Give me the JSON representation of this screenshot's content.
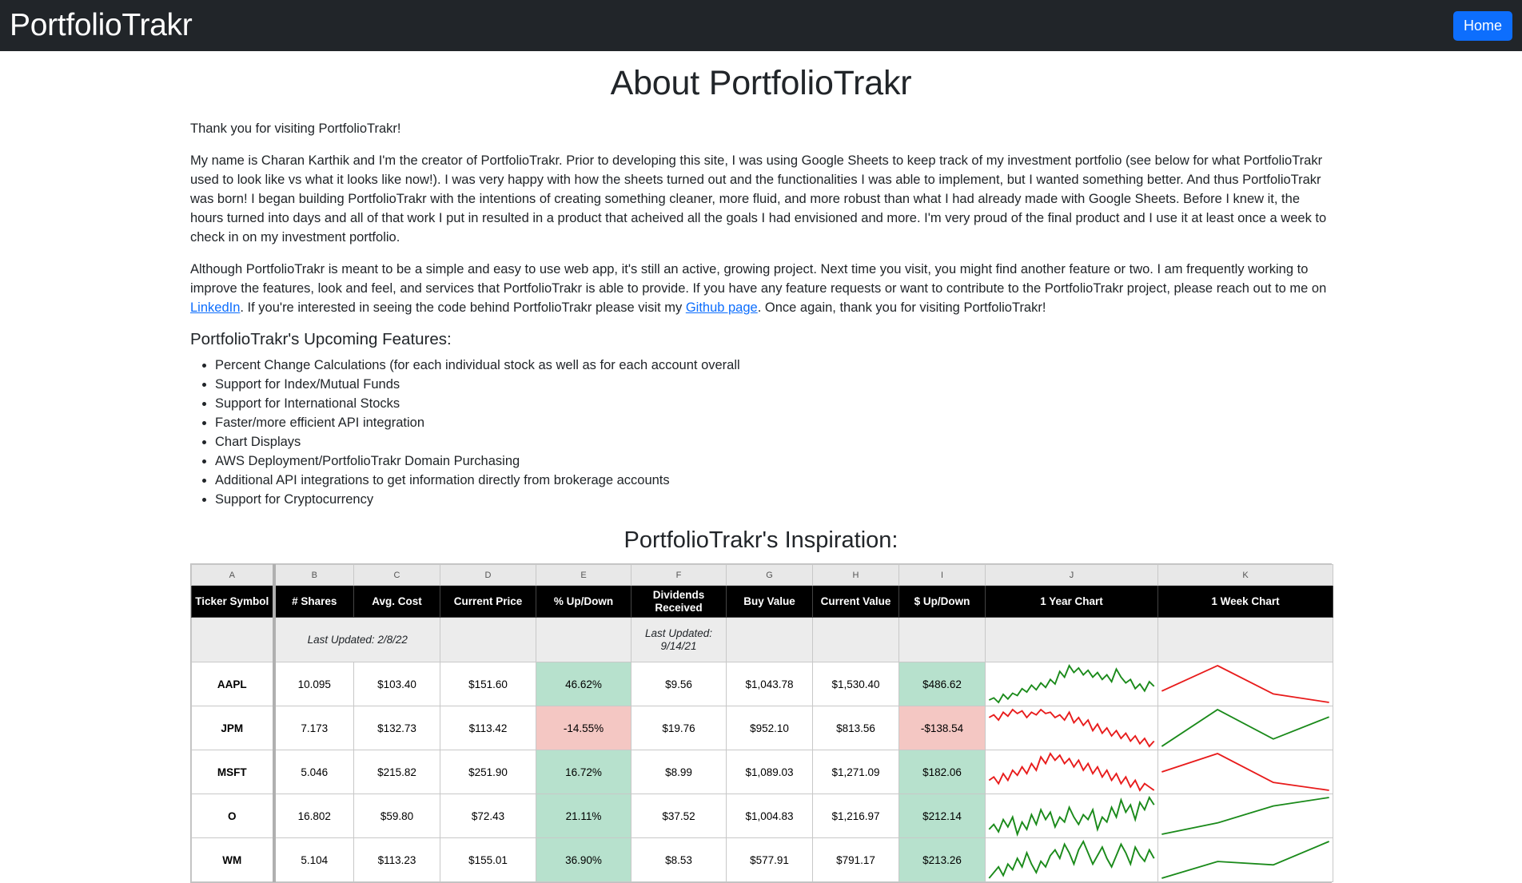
{
  "nav": {
    "brand": "PortfolioTrakr",
    "home": "Home"
  },
  "about": {
    "title": "About PortfolioTrakr",
    "greeting": "Thank you for visiting PortfolioTrakr!",
    "p1": "My name is Charan Karthik and I'm the creator of PortfolioTrakr. Prior to developing this site, I was using Google Sheets to keep track of my investment portfolio (see below for what PortfolioTrakr used to look like vs what it looks like now!). I was very happy with how the sheets turned out and the functionalities I was able to implement, but I wanted something better. And thus PortfolioTrakr was born! I began building PortfolioTrakr with the intentions of creating something cleaner, more fluid, and more robust than what I had already made with Google Sheets. Before I knew it, the hours turned into days and all of that work I put in resulted in a product that acheived all the goals I had envisioned and more. I'm very proud of the final product and I use it at least once a week to check in on my investment portfolio.",
    "p2_a": "Although PortfolioTrakr is meant to be a simple and easy to use web app, it's still an active, growing project. Next time you visit, you might find another feature or two. I am frequently working to improve the features, look and feel, and services that PortfolioTrakr is able to provide. If you have any feature requests or want to contribute to the PortfolioTrakr project, please reach out to me on ",
    "linkedin": "LinkedIn",
    "p2_b": ". If you're interested in seeing the code behind PortfolioTrakr please visit my ",
    "github": "Github page",
    "p2_c": ". Once again, thank you for visiting PortfolioTrakr!",
    "features_title": "PortfolioTrakr's Upcoming Features:",
    "features": [
      "Percent Change Calculations (for each individual stock as well as for each account overall",
      "Support for Index/Mutual Funds",
      "Support for International Stocks",
      "Faster/more efficient API integration",
      "Chart Displays",
      "AWS Deployment/PortfolioTrakr Domain Purchasing",
      "Additional API integrations to get information directly from brokerage accounts",
      "Support for Cryptocurrency"
    ],
    "inspiration_title": "PortfolioTrakr's Inspiration:"
  },
  "sheet": {
    "col_letters": [
      "A",
      "B",
      "C",
      "D",
      "E",
      "F",
      "G",
      "H",
      "I",
      "J",
      "K"
    ],
    "headers": [
      "Ticker Symbol",
      "# Shares",
      "Avg. Cost",
      "Current Price",
      "% Up/Down",
      "Dividends Received",
      "Buy Value",
      "Current Value",
      "$ Up/Down",
      "1 Year Chart",
      "1 Week Chart"
    ],
    "updated_b": "Last Updated: 2/8/22",
    "updated_f": "Last Updated: 9/14/21",
    "colors": {
      "up": "#b7e1cd",
      "down": "#f4c7c3",
      "green_line": "#1a8a1a",
      "red_line": "#e81b1b"
    },
    "rows": [
      {
        "ticker": "AAPL",
        "shares": "10.095",
        "avg": "$103.40",
        "price": "$151.60",
        "pct": "46.62%",
        "div": "$9.56",
        "buy": "$1,043.78",
        "cur": "$1,530.40",
        "usd": "$486.62",
        "status": "up",
        "year_trend": "up",
        "week_trend": "down",
        "year": [
          20,
          22,
          18,
          25,
          21,
          26,
          24,
          30,
          27,
          33,
          29,
          35,
          31,
          38,
          34,
          45,
          40,
          50,
          44,
          48,
          42,
          46,
          40,
          44,
          38,
          42,
          36,
          47,
          40,
          35,
          38,
          30,
          34,
          28,
          36,
          32
        ],
        "week": [
          30,
          48,
          28,
          22
        ]
      },
      {
        "ticker": "JPM",
        "shares": "7.173",
        "avg": "$132.73",
        "price": "$113.42",
        "pct": "-14.55%",
        "div": "$19.76",
        "buy": "$952.10",
        "cur": "$813.56",
        "usd": "-$138.54",
        "status": "down",
        "year_trend": "down",
        "week_trend": "up",
        "year": [
          40,
          42,
          38,
          44,
          41,
          46,
          43,
          45,
          40,
          44,
          42,
          46,
          43,
          44,
          40,
          42,
          38,
          44,
          36,
          40,
          34,
          38,
          30,
          35,
          28,
          32,
          26,
          30,
          24,
          28,
          22,
          26,
          20,
          24,
          18,
          22
        ],
        "week": [
          20,
          45,
          25,
          40
        ]
      },
      {
        "ticker": "MSFT",
        "shares": "5.046",
        "avg": "$215.82",
        "price": "$251.90",
        "pct": "16.72%",
        "div": "$8.99",
        "buy": "$1,089.03",
        "cur": "$1,271.09",
        "usd": "$182.06",
        "status": "up",
        "year_trend": "down",
        "week_trend": "down",
        "year": [
          30,
          32,
          28,
          34,
          30,
          36,
          33,
          38,
          34,
          40,
          36,
          44,
          40,
          46,
          42,
          45,
          40,
          43,
          38,
          42,
          36,
          40,
          34,
          38,
          32,
          36,
          30,
          34,
          28,
          32,
          26,
          30,
          24,
          28,
          26,
          24
        ],
        "week": [
          38,
          52,
          30,
          24
        ]
      },
      {
        "ticker": "O",
        "shares": "16.802",
        "avg": "$59.80",
        "price": "$72.43",
        "pct": "21.11%",
        "div": "$37.52",
        "buy": "$1,004.83",
        "cur": "$1,216.97",
        "usd": "$212.14",
        "status": "up",
        "year_trend": "up",
        "week_trend": "up",
        "year": [
          20,
          24,
          18,
          28,
          22,
          30,
          16,
          26,
          20,
          32,
          24,
          36,
          28,
          34,
          22,
          30,
          26,
          38,
          30,
          24,
          32,
          28,
          36,
          20,
          30,
          26,
          38,
          30,
          44,
          34,
          40,
          28,
          42,
          36,
          46,
          40
        ],
        "week": [
          14,
          22,
          34,
          40
        ]
      },
      {
        "ticker": "WM",
        "shares": "5.104",
        "avg": "$113.23",
        "price": "$155.01",
        "pct": "36.90%",
        "div": "$8.53",
        "buy": "$577.91",
        "cur": "$791.17",
        "usd": "$213.26",
        "status": "up",
        "year_trend": "up",
        "week_trend": "up",
        "year": [
          20,
          24,
          28,
          22,
          30,
          26,
          34,
          28,
          38,
          30,
          24,
          32,
          28,
          36,
          40,
          34,
          44,
          38,
          30,
          40,
          46,
          38,
          30,
          36,
          42,
          34,
          28,
          36,
          44,
          38,
          30,
          42,
          36,
          32,
          40,
          34
        ],
        "week": [
          18,
          28,
          26,
          40
        ]
      }
    ]
  }
}
